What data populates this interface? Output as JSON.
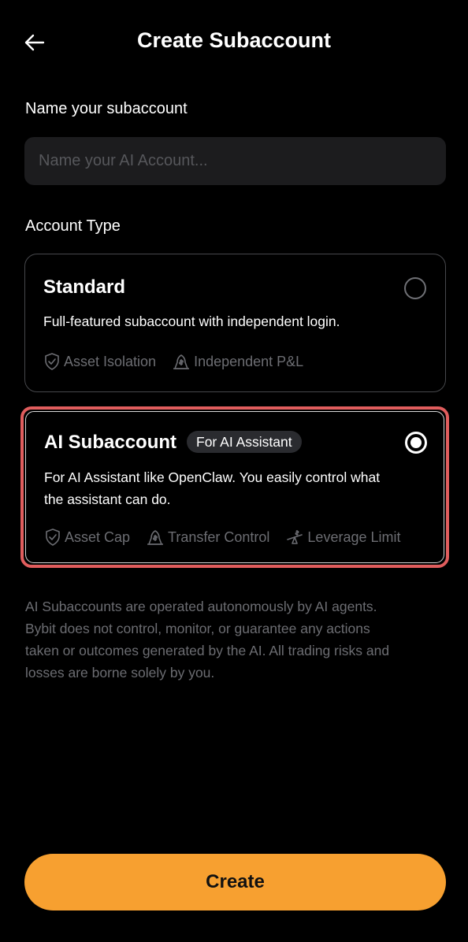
{
  "header": {
    "title": "Create Subaccount",
    "back_icon": "arrow-left-icon"
  },
  "name_section": {
    "label": "Name your subaccount",
    "input_value": "",
    "input_placeholder": "Name your AI Account..."
  },
  "account_type": {
    "label": "Account Type",
    "options": [
      {
        "title": "Standard",
        "description": "Full-featured subaccount with independent login.",
        "selected": false,
        "features": [
          {
            "icon": "shield-check-icon",
            "label": "Asset Isolation"
          },
          {
            "icon": "pnl-icon",
            "label": "Independent P&L"
          }
        ]
      },
      {
        "title": "AI Subaccount",
        "badge": "For AI Assistant",
        "description_line1": "For AI Assistant like OpenClaw. You easily control what",
        "description_line2": "the assistant can do.",
        "selected": true,
        "features": [
          {
            "icon": "shield-check-icon",
            "label": "Asset Cap"
          },
          {
            "icon": "transfer-control-icon",
            "label": "Transfer Control"
          },
          {
            "icon": "leverage-limit-icon",
            "label": "Leverage Limit"
          }
        ]
      }
    ]
  },
  "disclaimer": {
    "line1": "AI Subaccounts are operated autonomously by AI agents.",
    "line2": "Bybit does not control, monitor, or guarantee any actions",
    "line3": "taken or outcomes generated by the AI. All trading risks and",
    "line4": "losses are borne solely by you."
  },
  "create_button": {
    "label": "Create"
  },
  "colors": {
    "background": "#000000",
    "accent": "#f7a030",
    "highlight_border": "#e05d5d",
    "muted_text": "#6c6d72",
    "input_bg": "#1c1c1e"
  }
}
